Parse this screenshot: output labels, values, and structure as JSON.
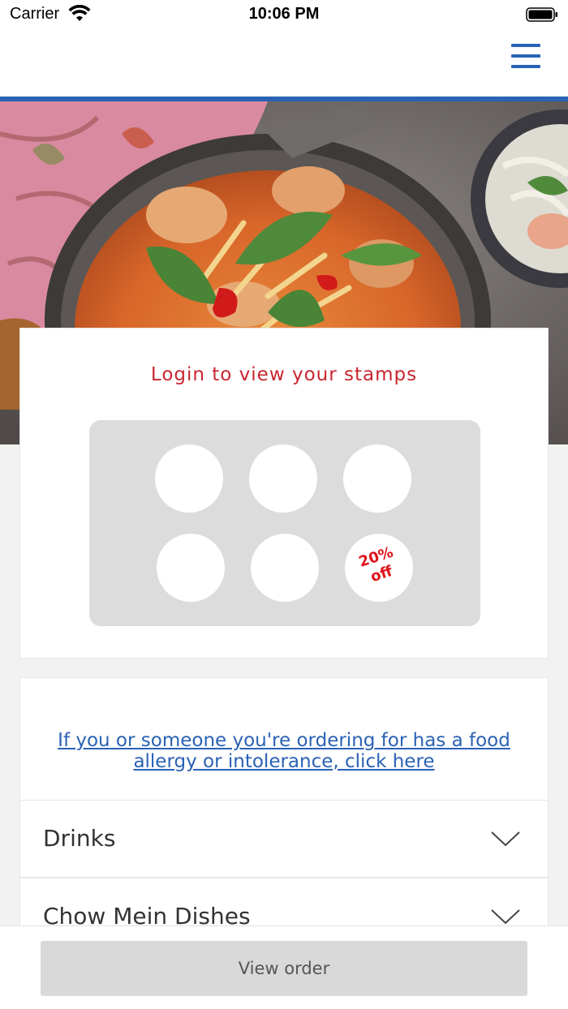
{
  "status_bar": {
    "carrier": "Carrier",
    "time": "10:06 PM"
  },
  "header": {
    "menu_icon": "hamburger-menu-icon",
    "accent_color": "#2a62b5"
  },
  "loyalty": {
    "title": "Login to view your stamps",
    "stamps_total": 6,
    "reward_text_line1": "20%",
    "reward_text_line2": "off",
    "title_color": "#c8262f",
    "reward_color": "#e0141c"
  },
  "allergy": {
    "link_text": "If you or someone you're ordering for has a food allergy or intolerance, click here"
  },
  "categories": [
    {
      "label": "Drinks",
      "icon": "chevron-down-icon"
    },
    {
      "label": "Chow Mein Dishes",
      "icon": "chevron-down-icon"
    }
  ],
  "footer": {
    "view_order_label": "View order"
  }
}
